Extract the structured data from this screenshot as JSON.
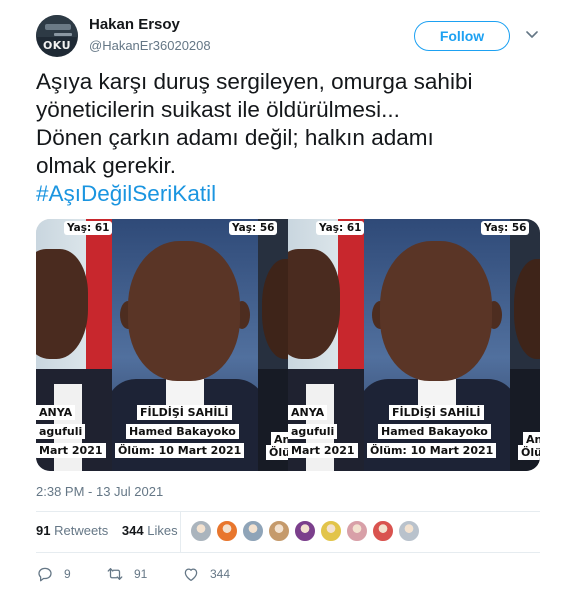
{
  "author": {
    "display_name": "Hakan Ersoy",
    "handle": "@HakanEr36020208",
    "avatar_word": "OKU"
  },
  "follow_label": "Follow",
  "tweet": {
    "lines": [
      "Aşıya karşı duruş sergileyen, omurga sahibi",
      "yöneticilerin suikast ile öldürülmesi...",
      "Dönen çarkın adamı değil; halkın adamı",
      "olmak  gerekir."
    ],
    "hashtag": "#AşıDeğilSeriKatil"
  },
  "media": {
    "age_left": "Yaş: 61",
    "age_center": "Yaş: 56",
    "caption_left": [
      "ANYA",
      "agufuli",
      "Mart 2021"
    ],
    "caption_center": [
      "FİLDİŞİ SAHİLİ",
      "Hamed Bakayoko",
      "Ölüm: 10 Mart 2021"
    ],
    "caption_right": [
      "An",
      "Ölüm"
    ]
  },
  "timestamp": "2:38 PM - 13 Jul 2021",
  "stats": {
    "retweets_count": "91",
    "retweets_label": "Retweets",
    "likes_count": "344",
    "likes_label": "Likes"
  },
  "liker_colors": [
    "#aab4bd",
    "#e8762d",
    "#8fa4b8",
    "#c59a6b",
    "#7b3f8c",
    "#e2c44a",
    "#d8a0a8",
    "#d9534f",
    "#b9c2cc"
  ],
  "actions": {
    "reply_count": "9",
    "retweet_count": "91",
    "like_count": "344"
  },
  "colors": {
    "accent": "#1da1f2",
    "hashtag": "#1b95e0",
    "secondary_text": "#657786"
  }
}
